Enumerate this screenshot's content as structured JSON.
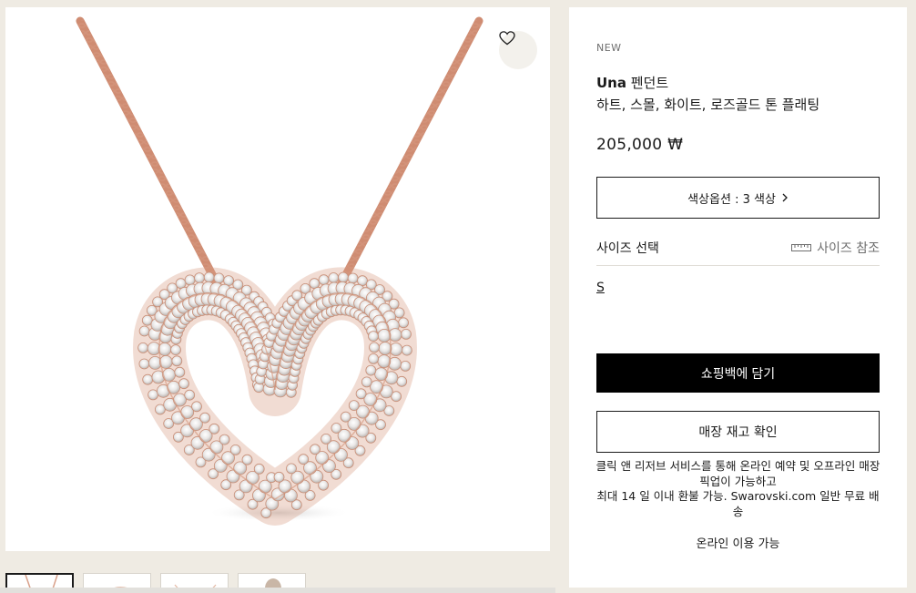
{
  "product": {
    "badge": "NEW",
    "name": "Una",
    "name_suffix": " 펜던트",
    "description": "하트, 스몰, 화이트, 로즈골드 톤 플래팅",
    "price": "205,000 ₩",
    "color_option": "색상옵션 : 3 색상",
    "size_label": "사이즈 선택",
    "size_guide": "사이즈 참조",
    "size_value": "S",
    "add_to_bag": "쇼핑백에 담기",
    "store_check": "매장 재고 확인",
    "click_reserve_line1": "클릭 앤 리저브 서비스를 통해 온라인 예약 및 오프라인 매장 픽업이 가능하고",
    "click_reserve_line2": "최대 14 일 이내 환불 가능. Swarovski.com 일반 무료 배송",
    "online_available": "온라인 이용 가능"
  },
  "icons": {
    "wishlist": "heart-outline-icon",
    "chevron": "chevron-right-icon",
    "ruler": "ruler-icon"
  },
  "colors": {
    "page_bg": "#efebe3",
    "rose_gold": "#d99a7c",
    "button_black": "#000000"
  }
}
